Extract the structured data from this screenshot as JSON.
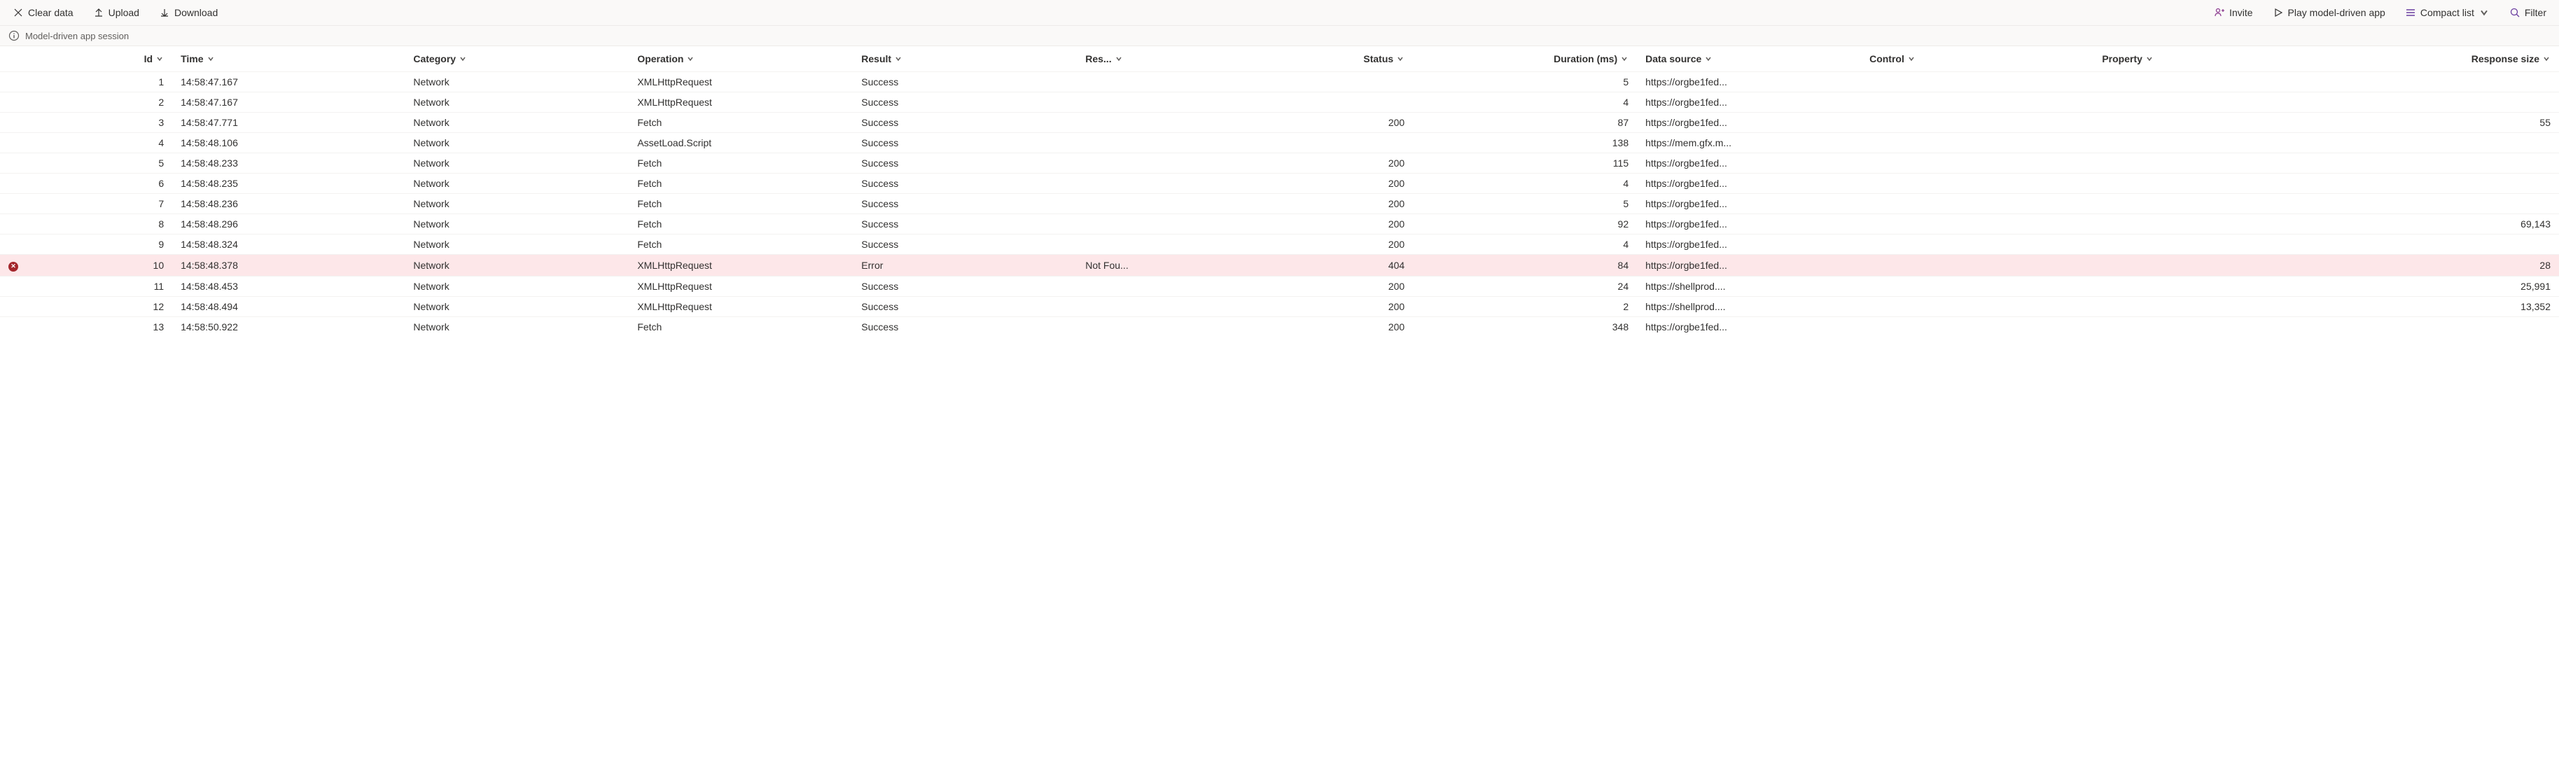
{
  "toolbar": {
    "left": {
      "clear_data": "Clear data",
      "upload": "Upload",
      "download": "Download"
    },
    "right": {
      "invite": "Invite",
      "play": "Play model-driven app",
      "compact_list": "Compact list",
      "filter": "Filter"
    }
  },
  "session": {
    "label": "Model-driven app session"
  },
  "columns": {
    "id": "Id",
    "time": "Time",
    "category": "Category",
    "operation": "Operation",
    "result": "Result",
    "res_reason": "Res...",
    "status": "Status",
    "duration": "Duration (ms)",
    "data_source": "Data source",
    "control": "Control",
    "property": "Property",
    "response_size": "Response size"
  },
  "rows": [
    {
      "id": "1",
      "time": "14:58:47.167",
      "category": "Network",
      "operation": "XMLHttpRequest",
      "result": "Success",
      "res_reason": "",
      "status": "",
      "duration": "5",
      "data_source": "https://orgbe1fed...",
      "control": "",
      "property": "",
      "response_size": "",
      "error": false
    },
    {
      "id": "2",
      "time": "14:58:47.167",
      "category": "Network",
      "operation": "XMLHttpRequest",
      "result": "Success",
      "res_reason": "",
      "status": "",
      "duration": "4",
      "data_source": "https://orgbe1fed...",
      "control": "",
      "property": "",
      "response_size": "",
      "error": false
    },
    {
      "id": "3",
      "time": "14:58:47.771",
      "category": "Network",
      "operation": "Fetch",
      "result": "Success",
      "res_reason": "",
      "status": "200",
      "duration": "87",
      "data_source": "https://orgbe1fed...",
      "control": "",
      "property": "",
      "response_size": "55",
      "error": false
    },
    {
      "id": "4",
      "time": "14:58:48.106",
      "category": "Network",
      "operation": "AssetLoad.Script",
      "result": "Success",
      "res_reason": "",
      "status": "",
      "duration": "138",
      "data_source": "https://mem.gfx.m...",
      "control": "",
      "property": "",
      "response_size": "",
      "error": false
    },
    {
      "id": "5",
      "time": "14:58:48.233",
      "category": "Network",
      "operation": "Fetch",
      "result": "Success",
      "res_reason": "",
      "status": "200",
      "duration": "115",
      "data_source": "https://orgbe1fed...",
      "control": "",
      "property": "",
      "response_size": "",
      "error": false
    },
    {
      "id": "6",
      "time": "14:58:48.235",
      "category": "Network",
      "operation": "Fetch",
      "result": "Success",
      "res_reason": "",
      "status": "200",
      "duration": "4",
      "data_source": "https://orgbe1fed...",
      "control": "",
      "property": "",
      "response_size": "",
      "error": false
    },
    {
      "id": "7",
      "time": "14:58:48.236",
      "category": "Network",
      "operation": "Fetch",
      "result": "Success",
      "res_reason": "",
      "status": "200",
      "duration": "5",
      "data_source": "https://orgbe1fed...",
      "control": "",
      "property": "",
      "response_size": "",
      "error": false
    },
    {
      "id": "8",
      "time": "14:58:48.296",
      "category": "Network",
      "operation": "Fetch",
      "result": "Success",
      "res_reason": "",
      "status": "200",
      "duration": "92",
      "data_source": "https://orgbe1fed...",
      "control": "",
      "property": "",
      "response_size": "69,143",
      "error": false
    },
    {
      "id": "9",
      "time": "14:58:48.324",
      "category": "Network",
      "operation": "Fetch",
      "result": "Success",
      "res_reason": "",
      "status": "200",
      "duration": "4",
      "data_source": "https://orgbe1fed...",
      "control": "",
      "property": "",
      "response_size": "",
      "error": false
    },
    {
      "id": "10",
      "time": "14:58:48.378",
      "category": "Network",
      "operation": "XMLHttpRequest",
      "result": "Error",
      "res_reason": "Not Fou...",
      "status": "404",
      "duration": "84",
      "data_source": "https://orgbe1fed...",
      "control": "",
      "property": "",
      "response_size": "28",
      "error": true
    },
    {
      "id": "11",
      "time": "14:58:48.453",
      "category": "Network",
      "operation": "XMLHttpRequest",
      "result": "Success",
      "res_reason": "",
      "status": "200",
      "duration": "24",
      "data_source": "https://shellprod....",
      "control": "",
      "property": "",
      "response_size": "25,991",
      "error": false
    },
    {
      "id": "12",
      "time": "14:58:48.494",
      "category": "Network",
      "operation": "XMLHttpRequest",
      "result": "Success",
      "res_reason": "",
      "status": "200",
      "duration": "2",
      "data_source": "https://shellprod....",
      "control": "",
      "property": "",
      "response_size": "13,352",
      "error": false
    },
    {
      "id": "13",
      "time": "14:58:50.922",
      "category": "Network",
      "operation": "Fetch",
      "result": "Success",
      "res_reason": "",
      "status": "200",
      "duration": "348",
      "data_source": "https://orgbe1fed...",
      "control": "",
      "property": "",
      "response_size": "",
      "error": false
    }
  ]
}
